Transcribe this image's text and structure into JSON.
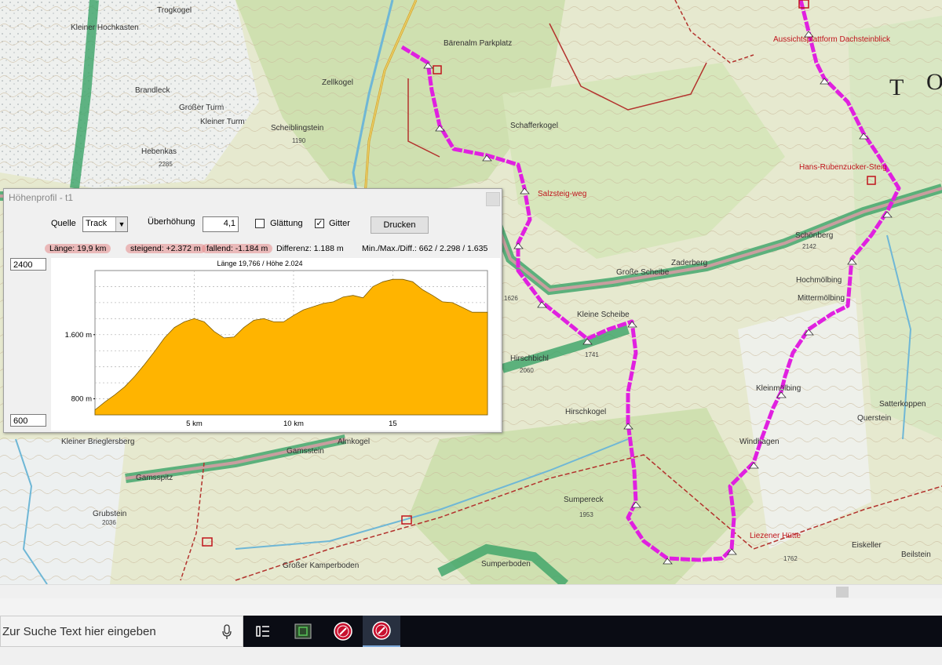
{
  "map": {
    "labels": [
      {
        "text": "Trogkogel",
        "cls": ""
      },
      {
        "text": "Kleiner Hochkasten",
        "cls": ""
      },
      {
        "text": "Brandleck",
        "cls": ""
      },
      {
        "text": "Großer Turm",
        "cls": ""
      },
      {
        "text": "Kleiner Turm",
        "cls": ""
      },
      {
        "text": "Hebenkas",
        "cls": ""
      },
      {
        "text": "Scheiblingstein",
        "cls": ""
      },
      {
        "text": "Zellkogel",
        "cls": ""
      },
      {
        "text": "Schafferkogel",
        "cls": ""
      },
      {
        "text": "Bärenalm Parkplatz",
        "cls": ""
      },
      {
        "text": "Salzsteig-weg",
        "cls": "red"
      },
      {
        "text": "Schönberg",
        "cls": ""
      },
      {
        "text": "Zaderberg",
        "cls": ""
      },
      {
        "text": "Große Scheibe",
        "cls": ""
      },
      {
        "text": "Kleine Scheibe",
        "cls": ""
      },
      {
        "text": "Hirschbichl",
        "cls": ""
      },
      {
        "text": "Hochmölbing",
        "cls": ""
      },
      {
        "text": "Mittermölbing",
        "cls": ""
      },
      {
        "text": "Kleinmölbing",
        "cls": ""
      },
      {
        "text": "Windhagen",
        "cls": ""
      },
      {
        "text": "Sumpereck",
        "cls": ""
      },
      {
        "text": "Hirschkogel",
        "cls": ""
      },
      {
        "text": "Gamsstein",
        "cls": ""
      },
      {
        "text": "Almkogel",
        "cls": ""
      },
      {
        "text": "Gamsspitz",
        "cls": ""
      },
      {
        "text": "Kleiner Brieglersberg",
        "cls": ""
      },
      {
        "text": "Grubstein",
        "cls": ""
      },
      {
        "text": "Großer Kamperboden",
        "cls": ""
      },
      {
        "text": "Sumperboden",
        "cls": ""
      },
      {
        "text": "Liezener Hütte",
        "cls": "red"
      },
      {
        "text": "Hans-Rubenzucker-Steig",
        "cls": "red"
      },
      {
        "text": "Aussichtsplattform Dachsteinblick",
        "cls": "red"
      },
      {
        "text": "Satterkoppen",
        "cls": ""
      },
      {
        "text": "Querstein",
        "cls": ""
      },
      {
        "text": "Eiskeller",
        "cls": ""
      },
      {
        "text": "Beilstein",
        "cls": ""
      },
      {
        "text": "T",
        "cls": "big"
      },
      {
        "text": "O",
        "cls": "big"
      },
      {
        "text": "2036",
        "cls": "num"
      },
      {
        "text": "1741",
        "cls": "num"
      },
      {
        "text": "2060",
        "cls": "num"
      },
      {
        "text": "1626",
        "cls": "num"
      },
      {
        "text": "2285",
        "cls": "num"
      },
      {
        "text": "1190",
        "cls": "num"
      },
      {
        "text": "2142",
        "cls": "num"
      },
      {
        "text": "1762",
        "cls": "num"
      },
      {
        "text": "1953",
        "cls": "num"
      }
    ]
  },
  "profile_window": {
    "title": "Höhenprofil - t1",
    "source_label": "Quelle",
    "source_value": "Track",
    "exaggeration_label": "Überhöhung",
    "exaggeration_value": "4,1",
    "smoothing_label": "Glättung",
    "smoothing_checked": false,
    "grid_label": "Gitter",
    "grid_checked": true,
    "print_label": "Drucken",
    "stats": {
      "length": "Länge: 19,9 km",
      "ascent": "steigend: +2.372 m",
      "descent": "fallend: -1.184 m",
      "difference": "Differenz: 1.188 m",
      "minmax": "Min./Max./Diff.: 662 / 2.298 / 1.635"
    },
    "ymax_value": "2400",
    "ymin_value": "600"
  },
  "chart_data": {
    "type": "area",
    "title": "Länge 19,766 / Höhe 2.024",
    "xlabel": "",
    "ylabel": "",
    "xlim": [
      0,
      19.766
    ],
    "ylim": [
      600,
      2400
    ],
    "x_ticks": [
      5,
      10,
      15
    ],
    "x_tick_labels": [
      "5 km",
      "10 km",
      "15"
    ],
    "y_ticks": [
      800,
      1600
    ],
    "y_tick_labels": [
      "800 m",
      "1.600 m"
    ],
    "grid": true,
    "color": "#ffb400",
    "x": [
      0,
      0.5,
      1,
      1.5,
      2,
      2.5,
      3,
      3.5,
      4,
      4.5,
      5,
      5.5,
      6,
      6.5,
      7,
      7.5,
      8,
      8.5,
      9,
      9.5,
      10,
      10.5,
      11,
      11.5,
      12,
      12.5,
      13,
      13.5,
      14,
      14.5,
      15,
      15.5,
      16,
      16.5,
      17,
      17.5,
      18,
      18.5,
      19,
      19.766
    ],
    "y": [
      662,
      760,
      850,
      950,
      1080,
      1230,
      1390,
      1560,
      1690,
      1760,
      1800,
      1760,
      1640,
      1560,
      1570,
      1690,
      1780,
      1800,
      1760,
      1760,
      1840,
      1910,
      1950,
      1990,
      2010,
      2070,
      2090,
      2060,
      2200,
      2260,
      2290,
      2290,
      2260,
      2160,
      2090,
      2010,
      2000,
      1940,
      1880,
      1880
    ]
  },
  "taskbar": {
    "search_placeholder": "Zur Suche Text hier eingeben"
  }
}
